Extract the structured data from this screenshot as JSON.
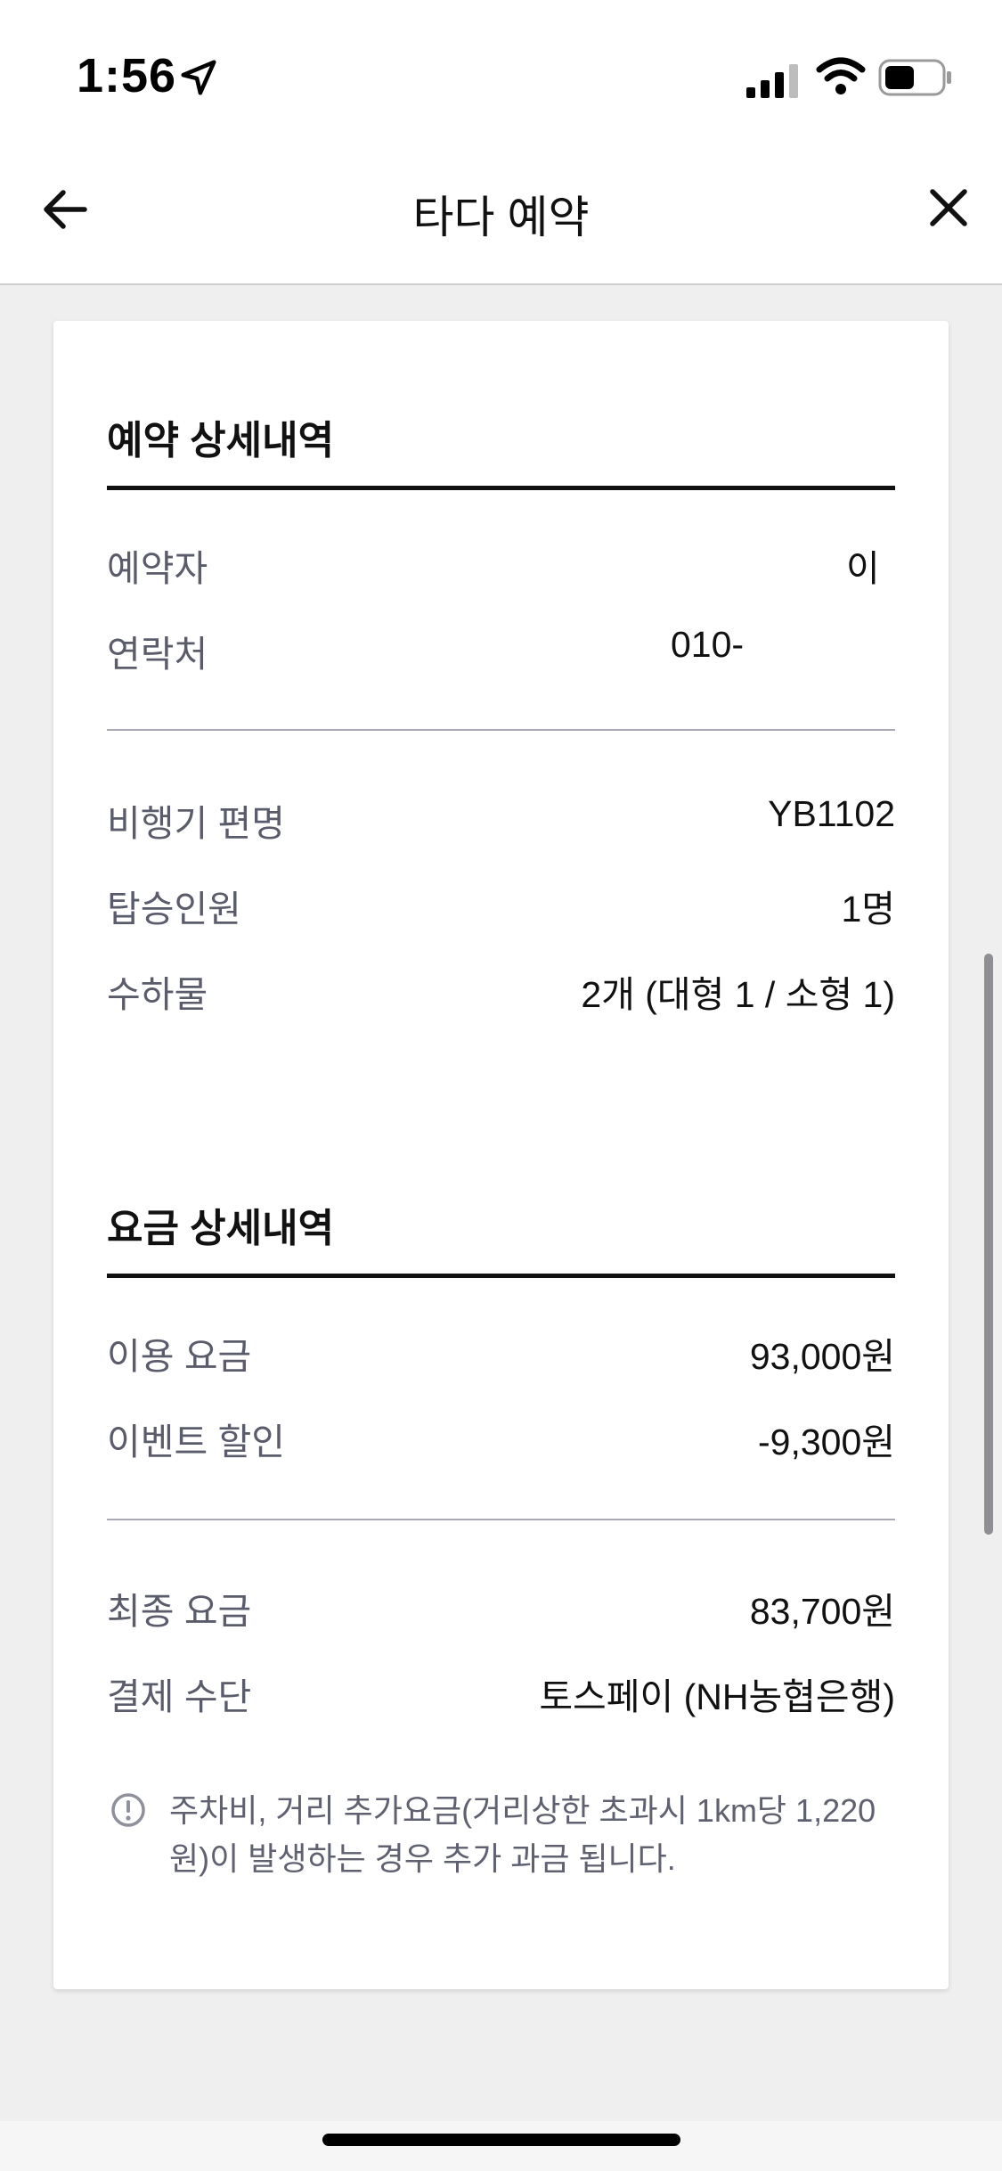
{
  "status_bar": {
    "time": "1:56",
    "icons": [
      "location-arrow-icon",
      "cellular-signal-icon",
      "wifi-icon",
      "battery-icon"
    ]
  },
  "header": {
    "title": "타다 예약",
    "back_icon": "arrow-left-icon",
    "close_icon": "close-icon"
  },
  "reservation": {
    "title": "예약 상세내역",
    "rows": [
      {
        "label": "예약자",
        "value": "이"
      },
      {
        "label": "연락처",
        "value": "010-"
      },
      {
        "label": "비행기 편명",
        "value": "YB1102"
      },
      {
        "label": "탑승인원",
        "value": "1명"
      },
      {
        "label": "수하물",
        "value": "2개 (대형 1 / 소형 1)"
      }
    ]
  },
  "fare": {
    "title": "요금 상세내역",
    "rows": [
      {
        "label": "이용 요금",
        "value": "93,000원"
      },
      {
        "label": "이벤트 할인",
        "value": "-9,300원"
      },
      {
        "label": "최종 요금",
        "value": "83,700원"
      },
      {
        "label": "결제 수단",
        "value": "토스페이 (NH농협은행)"
      }
    ],
    "notice": "주차비, 거리 추가요금(거리상한 초과시 1km당 1,220원)이 발생하는 경우 추가 과금 됩니다.",
    "notice_icon": "info-circle-icon"
  },
  "colors": {
    "background": "#efefef",
    "card": "#ffffff",
    "label": "#5a5c6b",
    "value": "#111111",
    "divider": "#a9a9b3"
  }
}
